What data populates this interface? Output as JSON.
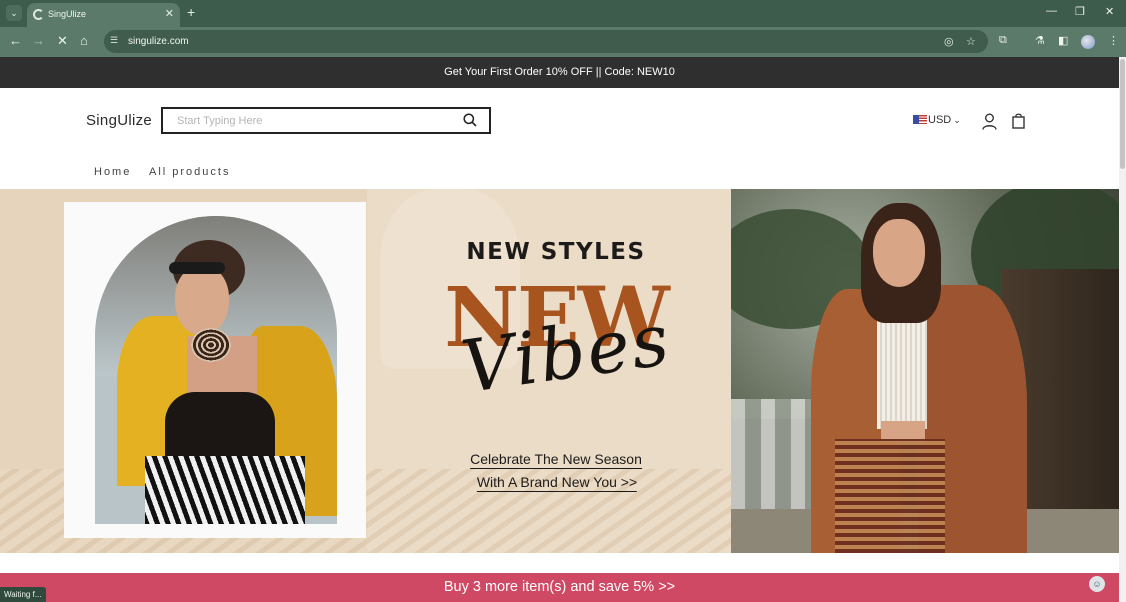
{
  "browser": {
    "tab_title": "SingUlize",
    "tab_close": "✕",
    "new_tab": "+",
    "url": "singulize.com",
    "status": "Waiting f...",
    "window_controls": [
      "—",
      "❐",
      "✕"
    ]
  },
  "promo": {
    "text": "Get Your First Order 10% OFF || Code: NEW10"
  },
  "header": {
    "logo": "SingUlize",
    "search_placeholder": "Start Typing Here",
    "currency": "USD",
    "nav": [
      "Home",
      "All products"
    ]
  },
  "hero": {
    "heading": "NEW STYLES",
    "big_word": "NEW",
    "script_word": "Vibes",
    "cta_line1": "Celebrate The New Season",
    "cta_line2": "With A Brand New You  >>"
  },
  "bundle": {
    "text": "Buy 3 more item(s) and save 5%  >>"
  },
  "colors": {
    "tabbar": "#3e5c4c",
    "toolbar": "#5b7a69",
    "promo_bg": "#2f2f2f",
    "hero_beige": "#e6d4bd",
    "hero_brown": "#a8541f",
    "bundle_bg": "#cf4965"
  },
  "icons": [
    "tab-list-icon",
    "loading-spinner-icon",
    "back-arrow-icon",
    "forward-arrow-icon",
    "stop-icon",
    "home-icon",
    "site-info-icon",
    "eye-off-icon",
    "star-icon",
    "extensions-icon",
    "labs-icon",
    "side-panel-icon",
    "menu-icon",
    "search-icon",
    "flag-icon",
    "chevron-down-icon",
    "user-icon",
    "shopping-bag-icon",
    "chat-icon"
  ]
}
